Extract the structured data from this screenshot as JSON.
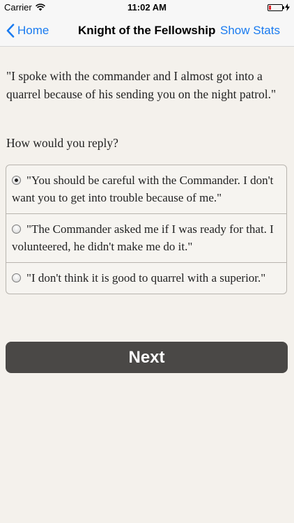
{
  "status_bar": {
    "carrier": "Carrier",
    "time": "11:02 AM",
    "battery_level": 0.15,
    "battery_color": "#e0262b"
  },
  "nav": {
    "back_label": "Home",
    "title": "Knight of the Fellowship",
    "right_label": "Show Stats",
    "accent_color": "#1a7bf0"
  },
  "story": {
    "text": "\"I spoke with the commander and I almost got into a quarrel because of his sending you on the night patrol.\"",
    "prompt": "How would you reply?"
  },
  "options": [
    {
      "text": "\"You should be careful with the Commander. I don't want you to get into trouble because of me.\"",
      "selected": true
    },
    {
      "text": "\"The Commander asked me if I was ready for that. I volunteered, he didn't make me do it.\"",
      "selected": false
    },
    {
      "text": "\"I don't think it is good to quarrel with a superior.\"",
      "selected": false
    }
  ],
  "next_button": {
    "label": "Next"
  },
  "icons": {
    "back": "chevron-left-icon",
    "wifi": "wifi-icon",
    "charging": "bolt-icon",
    "battery": "battery-icon"
  }
}
